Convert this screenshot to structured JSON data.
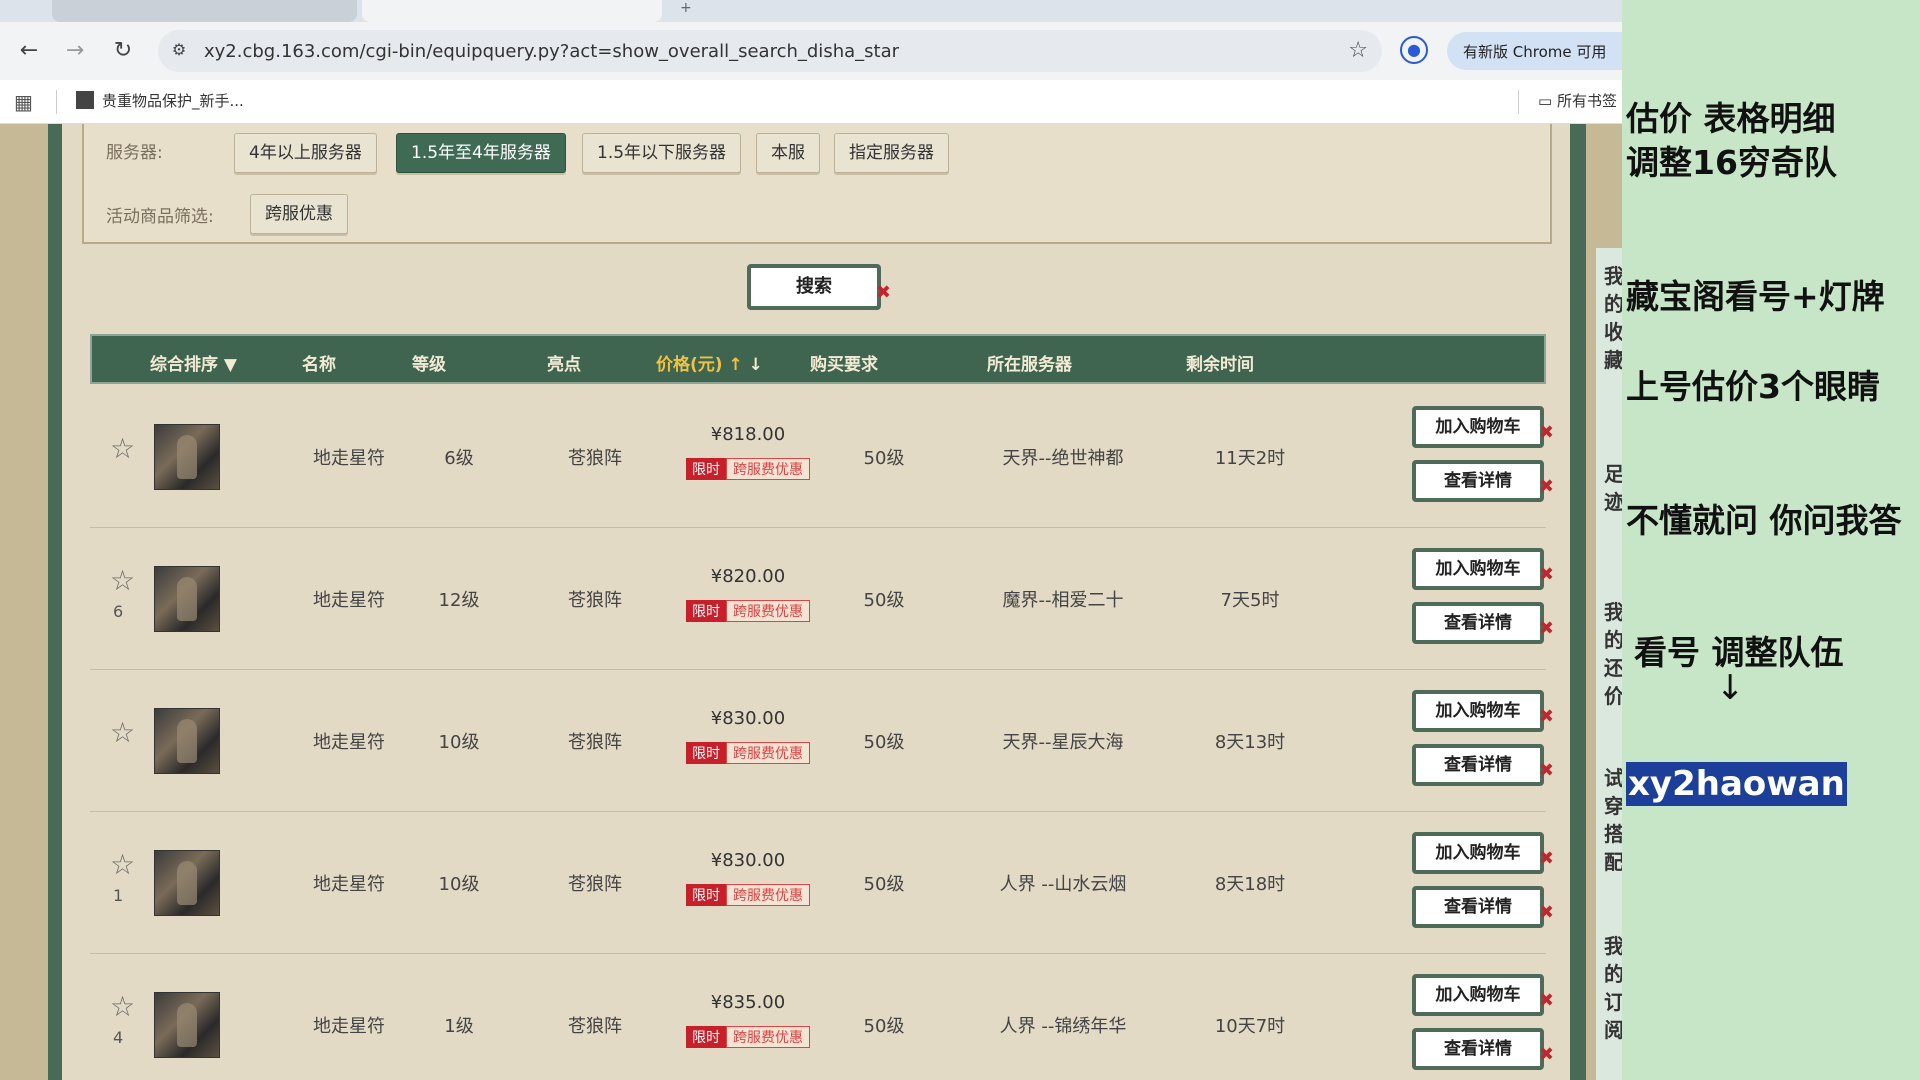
{
  "browser": {
    "url": "xy2.cbg.163.com/cgi-bin/equipquery.py?act=show_overall_search_disha_star",
    "update_label": "有新版 Chrome 可用",
    "bookmark_label": "贵重物品保护_新手...",
    "bookmark_folder": "所有书签"
  },
  "filters": {
    "server_label": "服务器:",
    "server_options": [
      "4年以上服务器",
      "1.5年至4年服务器",
      "1.5年以下服务器",
      "本服",
      "指定服务器"
    ],
    "active_server": "1.5年至4年服务器",
    "promo_label": "活动商品筛选:",
    "promo_option": "跨服优惠",
    "search_label": "搜索"
  },
  "table": {
    "headers": [
      "综合排序 ▼",
      "名称",
      "等级",
      "亮点",
      "价格(元)",
      "购买要求",
      "所在服务器",
      "剩余时间"
    ],
    "limit_tag": "限时",
    "cross_tag": "跨服费优惠",
    "add_cart_label": "加入购物车",
    "detail_label": "查看详情",
    "rows": [
      {
        "rank": "",
        "name": "地走星符",
        "level": "6级",
        "highlight": "苍狼阵",
        "price": "¥818.00",
        "req": "50级",
        "server": "天界--绝世神都",
        "remaining": "11天2时"
      },
      {
        "rank": "6",
        "name": "地走星符",
        "level": "12级",
        "highlight": "苍狼阵",
        "price": "¥820.00",
        "req": "50级",
        "server": "魔界--相爱二十",
        "remaining": "7天5时"
      },
      {
        "rank": "",
        "name": "地走星符",
        "level": "10级",
        "highlight": "苍狼阵",
        "price": "¥830.00",
        "req": "50级",
        "server": "天界--星辰大海",
        "remaining": "8天13时"
      },
      {
        "rank": "1",
        "name": "地走星符",
        "level": "10级",
        "highlight": "苍狼阵",
        "price": "¥830.00",
        "req": "50级",
        "server": "人界 --山水云烟",
        "remaining": "8天18时"
      },
      {
        "rank": "4",
        "name": "地走星符",
        "level": "1级",
        "highlight": "苍狼阵",
        "price": "¥835.00",
        "req": "50级",
        "server": "人界 --锦绣年华",
        "remaining": "10天7时"
      }
    ]
  },
  "side_notes": {
    "line1": "估价  表格明细",
    "line2": "调整16穷奇队",
    "line3": "藏宝阁看号+灯牌",
    "line4": "上号估价3个眼睛",
    "line5": "不懂就问 你问我答",
    "line6": "看号 调整队伍",
    "arrow": "↓",
    "handle": "xy2haowan",
    "strip": [
      "我的收藏",
      "足迹",
      "我的还价",
      "试穿搭配",
      "我的订阅"
    ]
  }
}
